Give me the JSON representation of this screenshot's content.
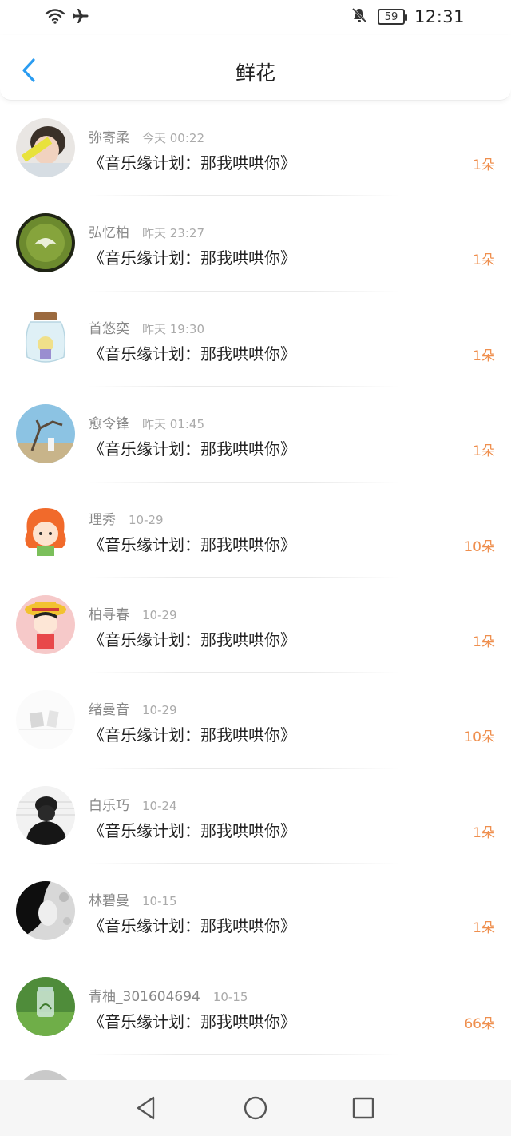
{
  "status_bar": {
    "time": "12:31",
    "battery": "59",
    "icons": [
      "wifi-icon",
      "airplane-icon",
      "bell-off-icon",
      "battery-icon"
    ]
  },
  "nav": {
    "title": "鲜花",
    "back_icon": "chevron-left-icon"
  },
  "colors": {
    "accent_blue": "#2a9cf1",
    "count_orange": "#ef8f4e",
    "name_grey": "#888888",
    "time_grey": "#aaaaaa"
  },
  "items": [
    {
      "name": "弥寄柔",
      "time": "今天 00:22",
      "title": "《音乐缘计划：那我哄哄你》",
      "count": "1朵"
    },
    {
      "name": "弘忆柏",
      "time": "昨天 23:27",
      "title": "《音乐缘计划：那我哄哄你》",
      "count": "1朵"
    },
    {
      "name": "首悠奕",
      "time": "昨天 19:30",
      "title": "《音乐缘计划：那我哄哄你》",
      "count": "1朵"
    },
    {
      "name": "愈令锋",
      "time": "昨天 01:45",
      "title": "《音乐缘计划：那我哄哄你》",
      "count": "1朵"
    },
    {
      "name": "理秀",
      "time": "10-29",
      "title": "《音乐缘计划：那我哄哄你》",
      "count": "10朵"
    },
    {
      "name": "柏寻春",
      "time": "10-29",
      "title": "《音乐缘计划：那我哄哄你》",
      "count": "1朵"
    },
    {
      "name": "绪曼音",
      "time": "10-29",
      "title": "《音乐缘计划：那我哄哄你》",
      "count": "10朵"
    },
    {
      "name": "白乐巧",
      "time": "10-24",
      "title": "《音乐缘计划：那我哄哄你》",
      "count": "1朵"
    },
    {
      "name": "林碧曼",
      "time": "10-15",
      "title": "《音乐缘计划：那我哄哄你》",
      "count": "1朵"
    },
    {
      "name": "青柚_301604694",
      "time": "10-15",
      "title": "《音乐缘计划：那我哄哄你》",
      "count": "66朵"
    }
  ],
  "system_nav": [
    "back-triangle-icon",
    "home-circle-icon",
    "recents-square-icon"
  ]
}
